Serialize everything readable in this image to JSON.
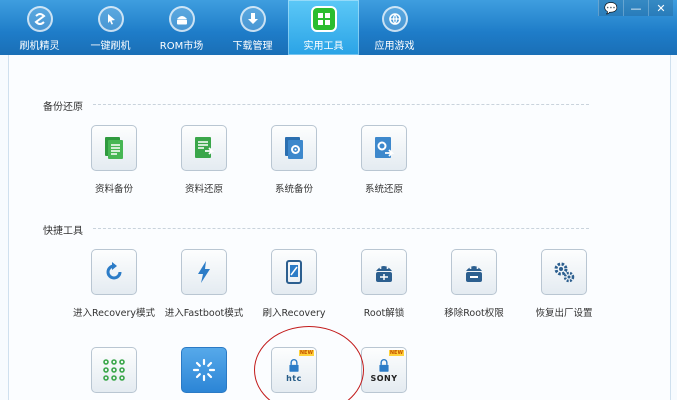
{
  "nav": {
    "items": [
      {
        "label": "刷机精灵",
        "icon": "logo-icon"
      },
      {
        "label": "一键刷机",
        "icon": "cursor-icon"
      },
      {
        "label": "ROM市场",
        "icon": "android-icon"
      },
      {
        "label": "下载管理",
        "icon": "download-icon"
      },
      {
        "label": "实用工具",
        "icon": "grid-icon",
        "active": true
      },
      {
        "label": "应用游戏",
        "icon": "ball-icon"
      }
    ]
  },
  "window_controls": {
    "feedback": "💬",
    "minimize": "—",
    "close": "✕"
  },
  "backup_section": {
    "title": "备份还原",
    "tools": [
      {
        "label": "资料备份",
        "icon": "doc-backup-icon"
      },
      {
        "label": "资料还原",
        "icon": "doc-restore-icon"
      },
      {
        "label": "系统备份",
        "icon": "system-backup-icon"
      },
      {
        "label": "系统还原",
        "icon": "system-restore-icon"
      }
    ]
  },
  "quick_section": {
    "title": "快捷工具",
    "tools": [
      {
        "label": "进入Recovery模式",
        "icon": "refresh-icon"
      },
      {
        "label": "进入Fastboot模式",
        "icon": "bolt-icon"
      },
      {
        "label": "刷入Recovery",
        "icon": "phone-flash-icon"
      },
      {
        "label": "Root解锁",
        "icon": "android-unlock-icon"
      },
      {
        "label": "移除Root权限",
        "icon": "android-remove-icon"
      },
      {
        "label": "恢复出厂设置",
        "icon": "gears-icon"
      }
    ]
  },
  "third_row": {
    "tools": [
      {
        "label": "",
        "icon": "dots-grid-icon"
      },
      {
        "label": "",
        "icon": "loading-icon"
      },
      {
        "brand": "htc",
        "badge": "NEW",
        "icon": "htc-unlock-icon"
      },
      {
        "brand": "SONY",
        "badge": "NEW",
        "icon": "sony-unlock-icon"
      }
    ]
  },
  "colors": {
    "accent": "#1e7cc8",
    "active_tab": "#2aa3e6",
    "tile_green": "#3aa64a",
    "highlight": "#c21b1b"
  }
}
